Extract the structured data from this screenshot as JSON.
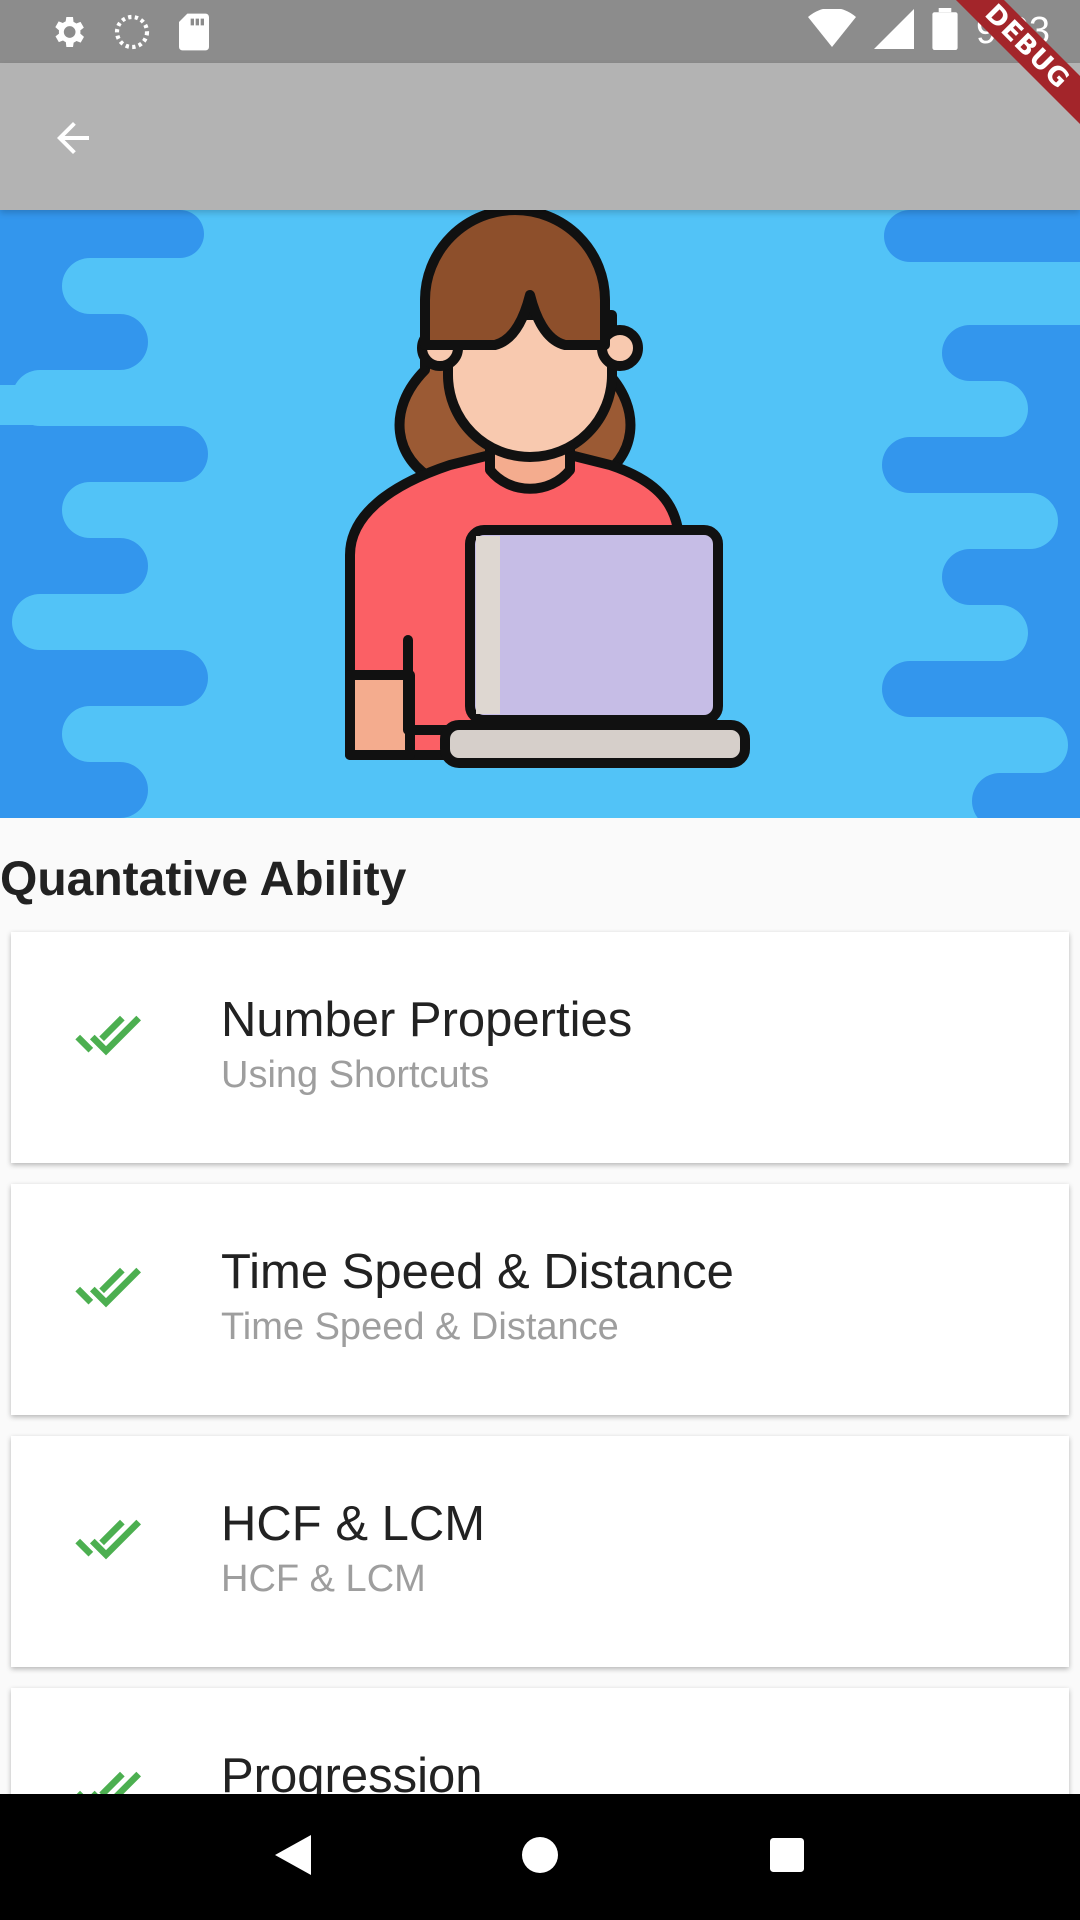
{
  "status_bar": {
    "time": "9:03",
    "left_icons": [
      "settings-icon",
      "sync-icon",
      "sd-card-icon"
    ],
    "right_icons": [
      "wifi-icon",
      "signal-icon",
      "battery-icon"
    ]
  },
  "debug_banner": {
    "label": "DEBUG",
    "color": "#a3252a"
  },
  "app_bar": {
    "back_icon": "arrow-back-icon",
    "color": "#b3b3b3"
  },
  "hero": {
    "background": "#52c3f7",
    "illustration": "woman-with-laptop"
  },
  "section": {
    "title": "Quantative Ability"
  },
  "topics": [
    {
      "title": "Number Properties",
      "subtitle": "Using Shortcuts",
      "icon": "double-check-icon"
    },
    {
      "title": "Time Speed & Distance",
      "subtitle": "Time Speed & Distance",
      "icon": "double-check-icon"
    },
    {
      "title": "HCF & LCM",
      "subtitle": "HCF & LCM",
      "icon": "double-check-icon"
    },
    {
      "title": "Progression",
      "subtitle": "",
      "icon": "double-check-icon"
    }
  ],
  "colors": {
    "check": "#4caf50",
    "title": "#222222",
    "subtitle": "#9e9e9e"
  },
  "nav_bar": {
    "buttons": [
      "back-triangle-icon",
      "home-circle-icon",
      "recents-square-icon"
    ]
  }
}
